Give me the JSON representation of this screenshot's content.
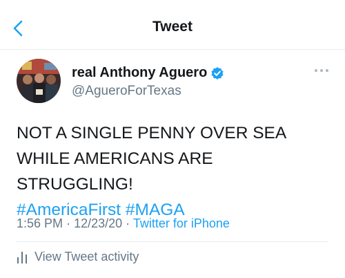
{
  "header": {
    "title": "Tweet",
    "back_icon": "chevron-left-icon"
  },
  "tweet": {
    "display_name": "real Anthony Aguero",
    "handle": "@AgueroForTexas",
    "verified_icon": "verified-badge-icon",
    "more_icon": "more-dots-icon",
    "text_line1": "NOT A SINGLE PENNY OVER SEA",
    "text_line2": "WHILE AMERICANS ARE STRUGGLING!",
    "hashtag1": "#AmericaFirst",
    "hashtag2": "#MAGA",
    "time": "1:56 PM",
    "date": "12/23/20",
    "separator": "·",
    "source": "Twitter for iPhone"
  },
  "activity": {
    "label": "View Tweet activity",
    "icon": "bar-chart-icon"
  },
  "colors": {
    "accent": "#1da1f2",
    "secondary_text": "#657786",
    "primary_text": "#14171a",
    "divider": "#e6ecf0"
  }
}
